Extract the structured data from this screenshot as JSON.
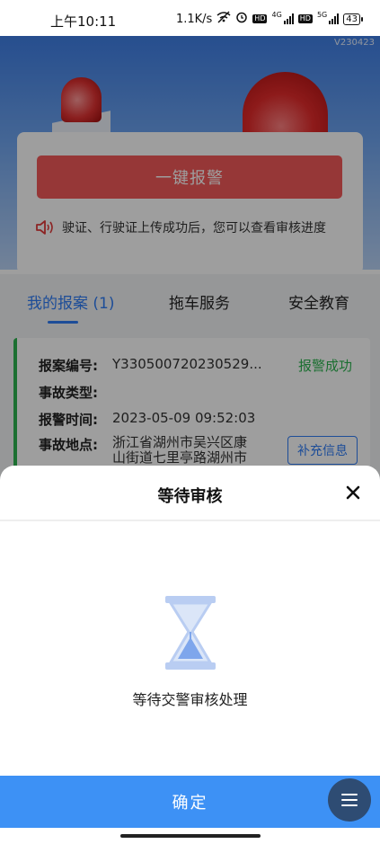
{
  "status_bar": {
    "time": "上午10:11",
    "net_speed": "1.1K/s",
    "battery": "43"
  },
  "app": {
    "version": "V230423",
    "report_button": "一键报警",
    "notice": "驶证、行驶证上传成功后，您可以查看审核进度",
    "tabs": [
      {
        "label": "我的报案 (1)",
        "active": true
      },
      {
        "label": "拖车服务",
        "active": false
      },
      {
        "label": "安全教育",
        "active": false
      }
    ],
    "case": {
      "number_label": "报案编号:",
      "number_value": "Y330500720230529...",
      "status": "报警成功",
      "type_label": "事故类型:",
      "type_value": "",
      "time_label": "报警时间:",
      "time_value": "2023-05-09 09:52:03",
      "location_label": "事故地点:",
      "location_value": "浙江省湖州市吴兴区康山街道七里亭路湖州市公安局交通警察支队",
      "supplement_button": "补充信息"
    }
  },
  "sheet": {
    "title": "等待审核",
    "message": "等待交警审核处理",
    "confirm_button": "确定"
  },
  "colors": {
    "accent_blue": "#2f7cf6",
    "confirm_blue": "#3d91f5",
    "success_green": "#2cb44f",
    "alarm_red": "#f35a5a"
  },
  "icons": [
    "wifi-off-icon",
    "alarm-clock-icon",
    "signal-icon",
    "battery-icon",
    "speaker-icon",
    "close-icon",
    "hourglass-icon",
    "menu-icon"
  ]
}
